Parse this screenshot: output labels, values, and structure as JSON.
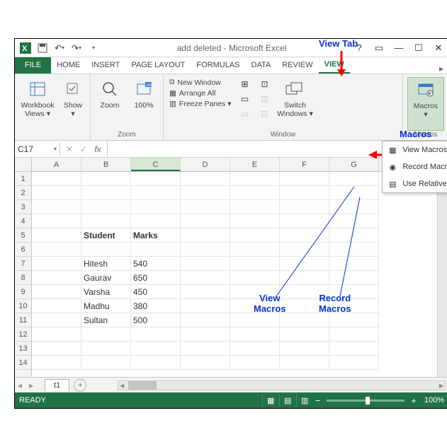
{
  "annotations": {
    "view_tab": "View Tab",
    "macros_tab": "Macros\nTab",
    "view_macros": "View\nMacros",
    "record_macros": "Record\nMacros"
  },
  "titlebar": {
    "title": "add deleted - Microsoft Excel"
  },
  "ribbon_tabs": {
    "file": "FILE",
    "tabs": [
      "HOME",
      "INSERT",
      "PAGE LAYOUT",
      "FORMULAS",
      "DATA",
      "REVIEW",
      "VIEW"
    ],
    "active": "VIEW"
  },
  "ribbon": {
    "workbook_views": "Workbook\nViews ▾",
    "show": "Show\n▾",
    "zoom_group": "Zoom",
    "zoom": "Zoom",
    "hundred": "100%",
    "window_group": "Window",
    "new_window": "New Window",
    "arrange_all": "Arrange All",
    "freeze_panes": "Freeze Panes ▾",
    "switch_windows": "Switch\nWindows ▾",
    "macros_group": "Macros",
    "macros": "Macros\n▾"
  },
  "macros_menu": {
    "view": "View Macros",
    "record": "Record Macro...",
    "relative": "Use Relative References"
  },
  "formula_bar": {
    "name_box": "C17",
    "fx": "fx"
  },
  "columns": [
    "A",
    "B",
    "C",
    "D",
    "E",
    "F",
    "G"
  ],
  "rows": [
    "1",
    "2",
    "3",
    "4",
    "5",
    "6",
    "7",
    "8",
    "9",
    "10",
    "11",
    "12",
    "13",
    "14"
  ],
  "selected_col": "C",
  "data": {
    "headers": {
      "b5": "Student",
      "c5": "Marks"
    },
    "rows": [
      {
        "b": "Hitesh",
        "c": "540"
      },
      {
        "b": "Gaurav",
        "c": "650"
      },
      {
        "b": "Varsha",
        "c": "450"
      },
      {
        "b": "Madhu",
        "c": "380"
      },
      {
        "b": "Sultan",
        "c": "500"
      }
    ]
  },
  "sheet": {
    "name": "t1"
  },
  "status": {
    "ready": "READY",
    "zoom": "100%"
  }
}
